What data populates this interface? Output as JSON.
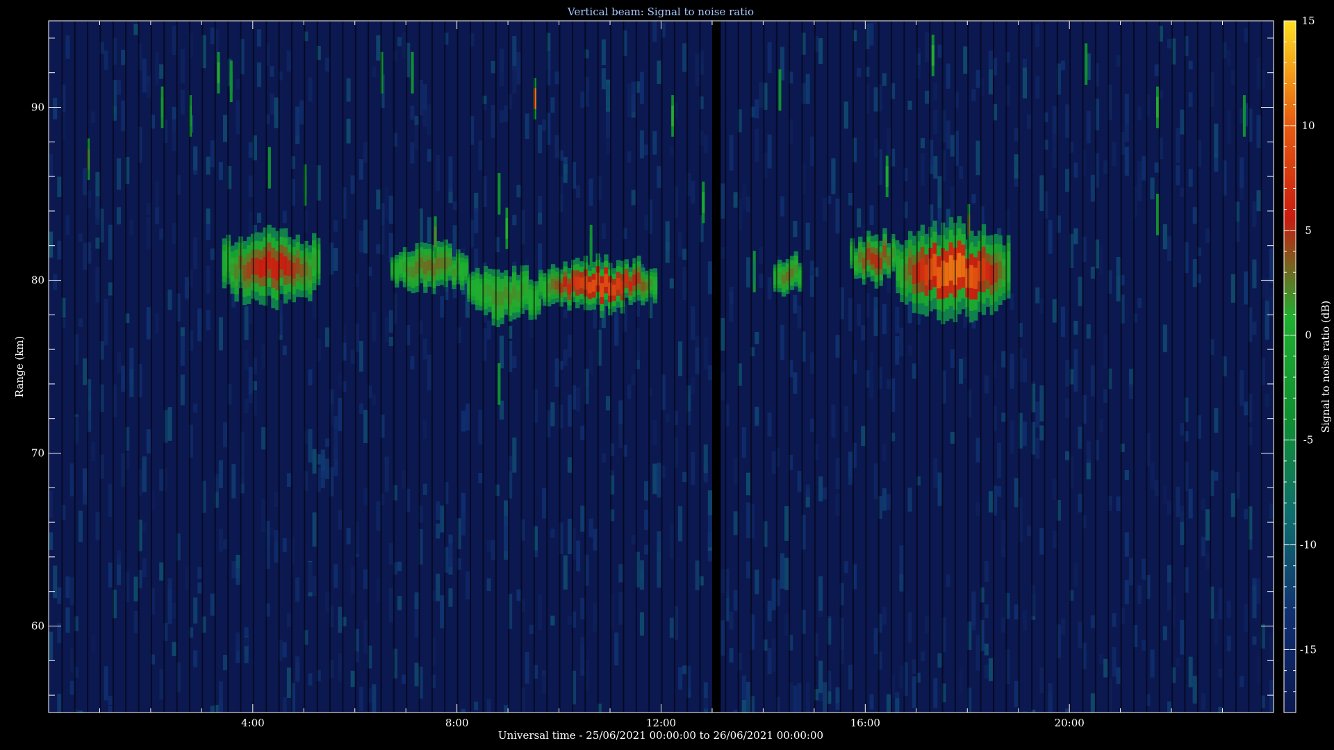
{
  "chart_data": {
    "type": "heatmap",
    "title": "Vertical beam: Signal to noise ratio",
    "xlabel": "Universal time - 25/06/2021 00:00:00 to 26/06/2021 00:00:00",
    "ylabel": "Range (km)",
    "colorbar_label": "Signal to noise ratio (dB)",
    "x_unit": "hours UT",
    "xlim": [
      0,
      24
    ],
    "ylim": [
      55,
      95
    ],
    "x_major_ticks": [
      {
        "value": 4,
        "label": "4:00"
      },
      {
        "value": 8,
        "label": "8:00"
      },
      {
        "value": 12,
        "label": "12:00"
      },
      {
        "value": 16,
        "label": "16:00"
      },
      {
        "value": 20,
        "label": "20:00"
      }
    ],
    "y_major_ticks": [
      {
        "value": 60,
        "label": "60"
      },
      {
        "value": 70,
        "label": "70"
      },
      {
        "value": 80,
        "label": "80"
      },
      {
        "value": 90,
        "label": "90"
      }
    ],
    "colorbar": {
      "range": [
        -18,
        15
      ],
      "ticks": [
        {
          "value": 15,
          "label": "15"
        },
        {
          "value": 10,
          "label": "10"
        },
        {
          "value": 5,
          "label": "5"
        },
        {
          "value": 0,
          "label": "0"
        },
        {
          "value": -5,
          "label": "-5"
        },
        {
          "value": -10,
          "label": "-10"
        },
        {
          "value": -15,
          "label": "-15"
        }
      ],
      "colors": [
        "#0c1850",
        "#103070",
        "#0f6e6e",
        "#109030",
        "#20b030",
        "#c81c10",
        "#e86010",
        "#ffe020"
      ]
    },
    "background_snr_db": -16,
    "data_gaps_hours": [
      13.0,
      13.05,
      13.1
    ],
    "echo_regions": [
      {
        "name": "",
        "t_start": 3.4,
        "t_end": 5.3,
        "range_center": 80.8,
        "range_half_width": 2.3,
        "peak_snr": 6
      },
      {
        "name": "",
        "t_start": 6.7,
        "t_end": 8.2,
        "range_center": 80.8,
        "range_half_width": 1.4,
        "peak_snr": 3
      },
      {
        "name": "",
        "t_start": 8.2,
        "t_end": 9.6,
        "range_center": 79.2,
        "range_half_width": 1.6,
        "peak_snr": 2
      },
      {
        "name": "",
        "t_start": 9.6,
        "t_end": 11.9,
        "range_center": 79.8,
        "range_half_width": 1.5,
        "peak_snr": 9
      },
      {
        "name": "",
        "t_start": 14.2,
        "t_end": 14.7,
        "range_center": 80.3,
        "range_half_width": 1.2,
        "peak_snr": 3
      },
      {
        "name": "",
        "t_start": 15.7,
        "t_end": 16.6,
        "range_center": 81.3,
        "range_half_width": 1.5,
        "peak_snr": 5
      },
      {
        "name": "",
        "t_start": 16.6,
        "t_end": 18.8,
        "range_center": 80.5,
        "range_half_width": 2.8,
        "peak_snr": 11
      }
    ],
    "isolated_echoes": [
      {
        "t": 0.75,
        "range": 87,
        "snr": 2
      },
      {
        "t": 2.2,
        "range": 90,
        "snr": -3
      },
      {
        "t": 2.75,
        "range": 89.5,
        "snr": -2
      },
      {
        "t": 3.3,
        "range": 92,
        "snr": 1
      },
      {
        "t": 3.55,
        "range": 91.5,
        "snr": -4
      },
      {
        "t": 4.3,
        "range": 86.5,
        "snr": -4
      },
      {
        "t": 5.0,
        "range": 85.5,
        "snr": -4
      },
      {
        "t": 6.5,
        "range": 92,
        "snr": -4
      },
      {
        "t": 7.1,
        "range": 92,
        "snr": -4
      },
      {
        "t": 7.55,
        "range": 82.5,
        "snr": 2
      },
      {
        "t": 8.8,
        "range": 85,
        "snr": -4
      },
      {
        "t": 8.95,
        "range": 83,
        "snr": 1
      },
      {
        "t": 8.8,
        "range": 74,
        "snr": -4
      },
      {
        "t": 9.5,
        "range": 90.5,
        "snr": 11
      },
      {
        "t": 10.6,
        "range": 82,
        "snr": -4
      },
      {
        "t": 12.2,
        "range": 89.5,
        "snr": 1
      },
      {
        "t": 12.8,
        "range": 84.5,
        "snr": 0
      },
      {
        "t": 13.0,
        "range": 73.5,
        "snr": -4
      },
      {
        "t": 13.8,
        "range": 80.5,
        "snr": -6
      },
      {
        "t": 14.3,
        "range": 91,
        "snr": -4
      },
      {
        "t": 16.4,
        "range": 86,
        "snr": 0
      },
      {
        "t": 17.3,
        "range": 93,
        "snr": 1
      },
      {
        "t": 18.0,
        "range": 83.2,
        "snr": 3
      },
      {
        "t": 20.3,
        "range": 92.5,
        "snr": -4
      },
      {
        "t": 21.7,
        "range": 90,
        "snr": 1
      },
      {
        "t": 21.7,
        "range": 83.8,
        "snr": -4
      },
      {
        "t": 23.4,
        "range": 89.5,
        "snr": -4
      }
    ]
  }
}
